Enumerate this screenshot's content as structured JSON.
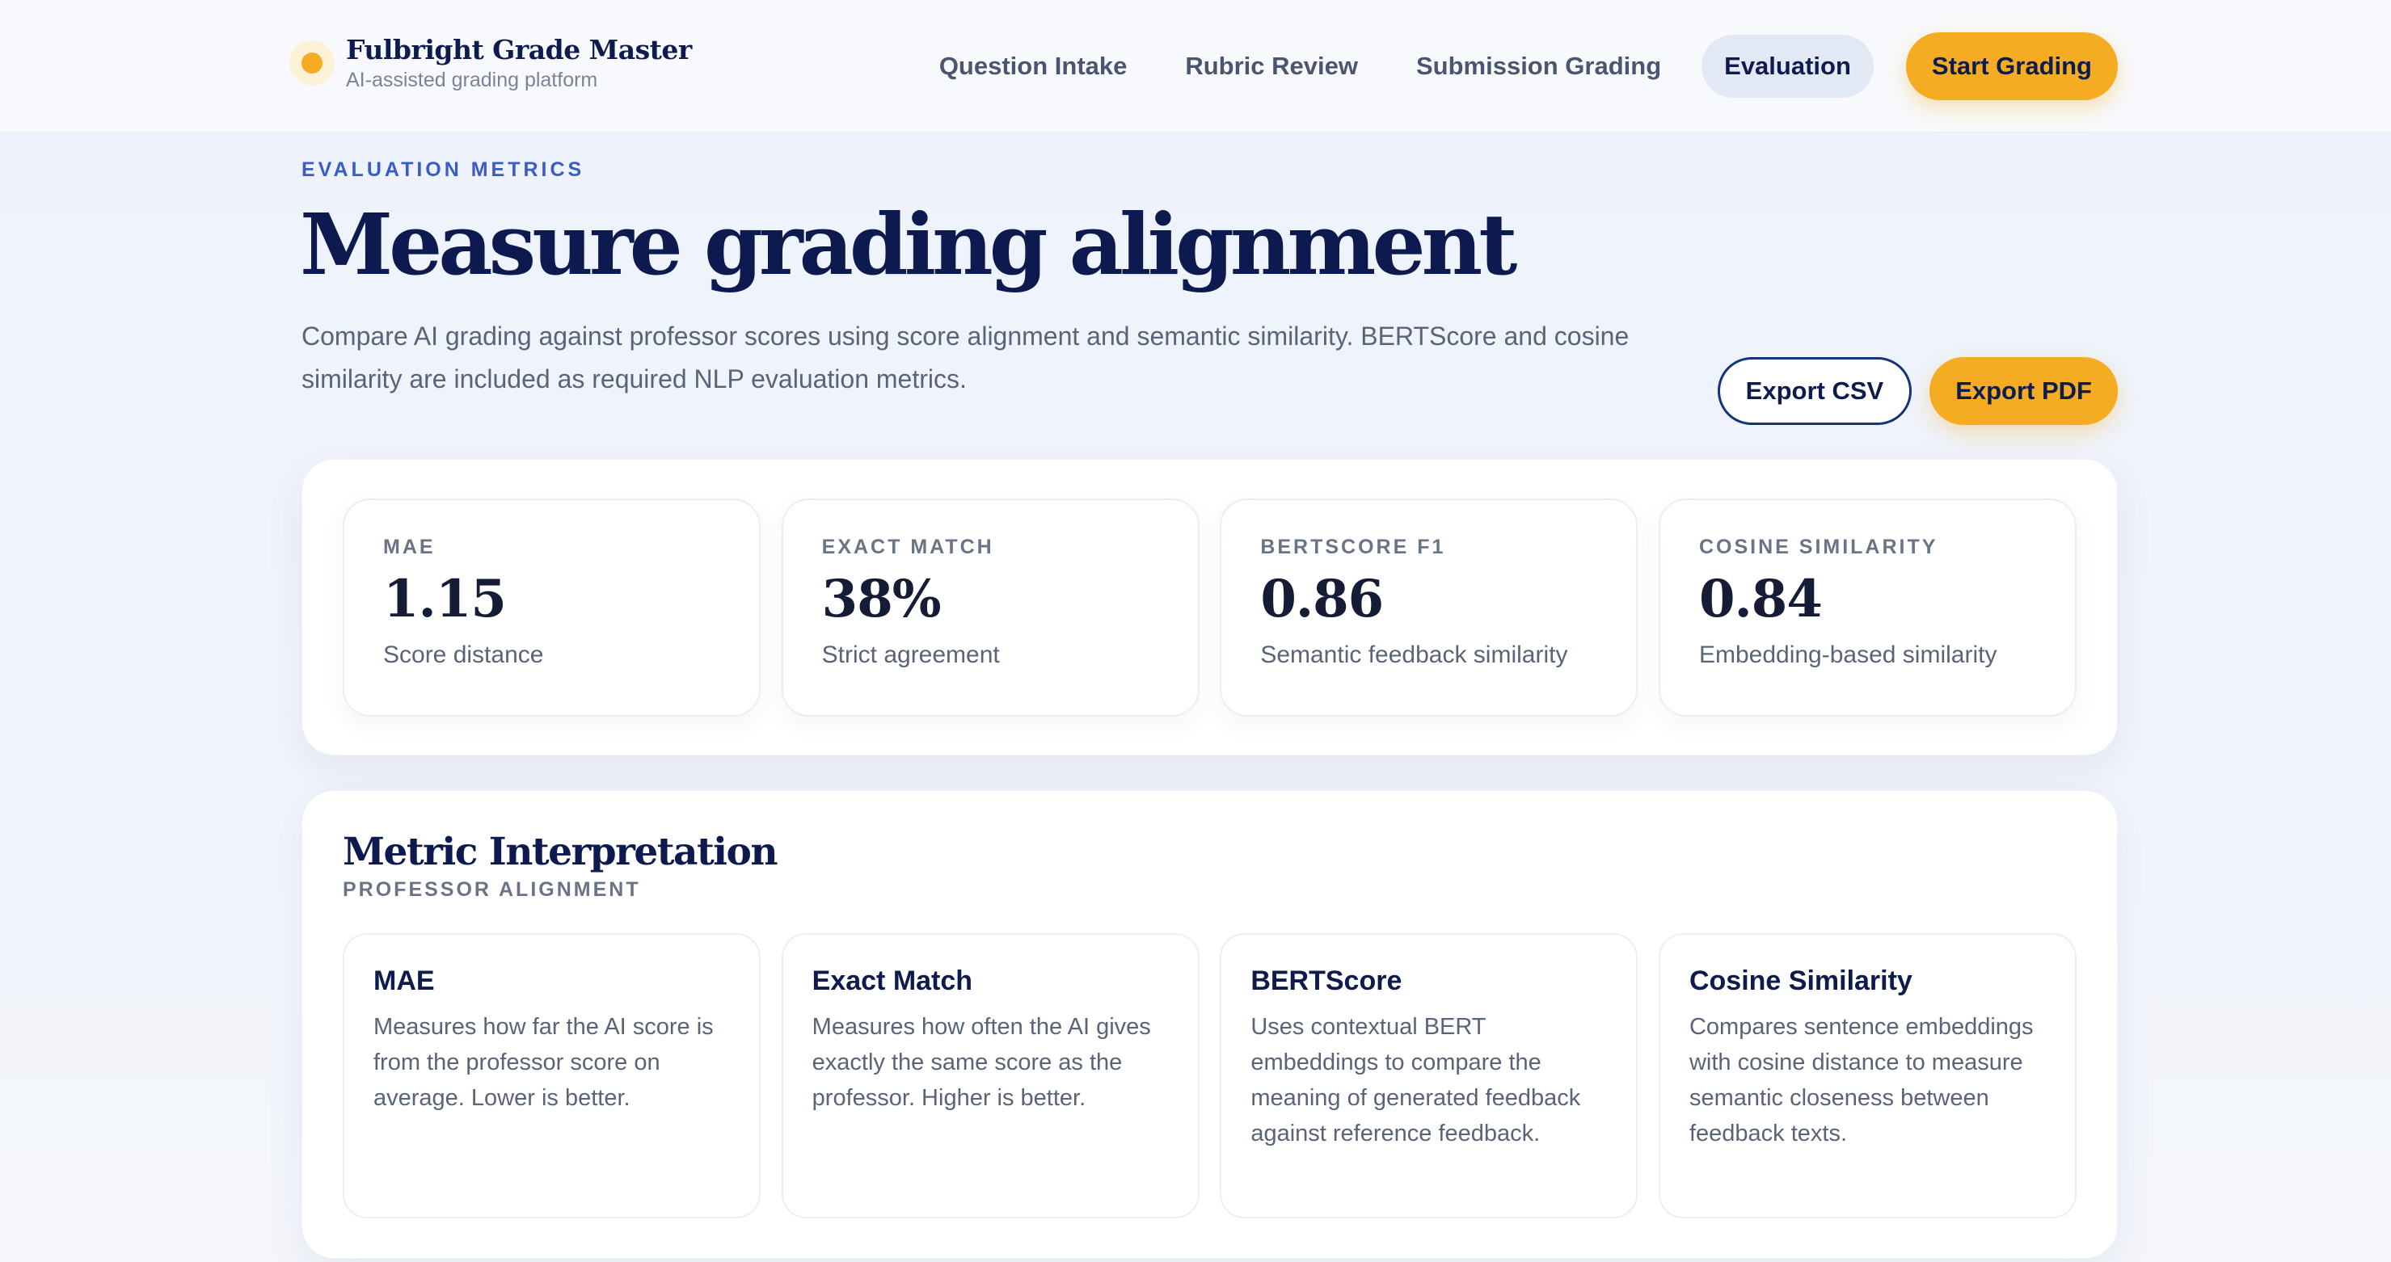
{
  "brand": {
    "title": "Fulbright Grade Master",
    "subtitle": "AI-assisted grading platform"
  },
  "nav": {
    "items": [
      {
        "label": "Question Intake",
        "active": false
      },
      {
        "label": "Rubric Review",
        "active": false
      },
      {
        "label": "Submission Grading",
        "active": false
      },
      {
        "label": "Evaluation",
        "active": true
      }
    ],
    "cta_label": "Start Grading"
  },
  "hero": {
    "eyebrow": "EVALUATION METRICS",
    "title": "Measure grading alignment",
    "description": "Compare AI grading against professor scores using score alignment and semantic similarity. BERTScore and cosine similarity are included as required NLP evaluation metrics.",
    "export_csv_label": "Export CSV",
    "export_pdf_label": "Export PDF"
  },
  "metrics": [
    {
      "label": "MAE",
      "value": "1.15",
      "description": "Score distance"
    },
    {
      "label": "EXACT MATCH",
      "value": "38%",
      "description": "Strict agreement"
    },
    {
      "label": "BERTSCORE F1",
      "value": "0.86",
      "description": "Semantic feedback similarity"
    },
    {
      "label": "COSINE SIMILARITY",
      "value": "0.84",
      "description": "Embedding-based similarity"
    }
  ],
  "interpretation": {
    "title": "Metric Interpretation",
    "subtitle": "PROFESSOR ALIGNMENT",
    "cards": [
      {
        "name": "MAE",
        "text": "Measures how far the AI score is from the professor score on average. Lower is better."
      },
      {
        "name": "Exact Match",
        "text": "Measures how often the AI gives exactly the same score as the professor. Higher is better."
      },
      {
        "name": "BERTScore",
        "text": "Uses contextual BERT embeddings to compare the meaning of generated feedback against reference feedback."
      },
      {
        "name": "Cosine Similarity",
        "text": "Compares sentence embeddings with cosine distance to measure semantic closeness between feedback texts."
      }
    ]
  },
  "colors": {
    "accent": "#f5ac22",
    "navy": "#0e1b4d",
    "eyebrow_blue": "#3a5cc4"
  }
}
